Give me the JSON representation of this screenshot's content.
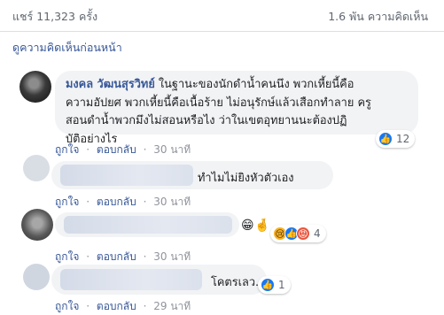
{
  "header": {
    "shares": "แชร์ 11,323 ครั้ง",
    "comments": "1.6 พัน ความคิดเห็น"
  },
  "previous_link": "ดูความคิดเห็นก่อนหน้า",
  "actions": {
    "like": "ถูกใจ",
    "reply": "ตอบกลับ",
    "separator": "·"
  },
  "comments": [
    {
      "author": "มงคล วัฒนสุรวิทย์",
      "text_lines": [
        " ในฐานะของนักดำน้ำคนนึง พวกเหี้ยนี้คือ",
        "ความอัปยศ พวกเหี้ยนี้คือเนื้อร้าย ไม่อนุรักษ์แล้วเสือกทำลาย ครู",
        "สอนดำน้ำพวกมึงไม่สอนหรือไง ว่าในเขตอุทยานนะต้องปฏิ",
        "บัติอย่างไร"
      ],
      "time": "30 นาที",
      "reaction_count": "12"
    },
    {
      "text": "ทำไมไม่ยิงหัวตัวเอง",
      "time": "30 นาที"
    },
    {
      "emojis": [
        "😁",
        "🤞"
      ],
      "time": "30 นาที",
      "reaction_count": "4"
    },
    {
      "text": "โคตรเลว..",
      "time": "29 นาที",
      "reaction_count": "1"
    }
  ],
  "colors": {
    "link": "#385898",
    "like": "#1877f2",
    "bubble": "#f2f3f5",
    "muted": "#90949c"
  }
}
